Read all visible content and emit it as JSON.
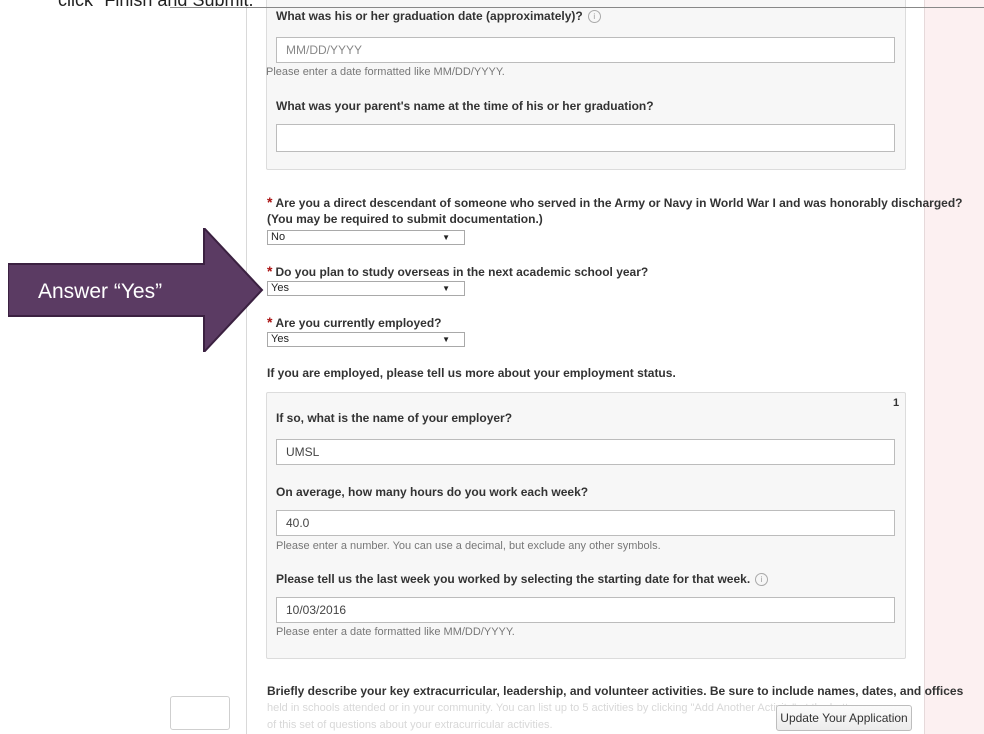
{
  "caption": {
    "text": "click \"Finish and Submit.\""
  },
  "callout": {
    "text": "Answer “Yes”",
    "color": "#5b3b63"
  },
  "graduation": {
    "date_question": "What was his or her graduation date (approximately)?",
    "date_placeholder": "MM/DD/YYYY",
    "date_hint": "Please enter a date formatted like MM/DD/YYYY.",
    "parent_question": "What was your parent's name at the time of his or her graduation?",
    "parent_value": ""
  },
  "descendant": {
    "required_mark": "*",
    "question_line1": "Are you a direct descendant of someone who served in the Army or Navy in World War I and was honorably discharged?",
    "question_line2": "(You may be required to submit documentation.)",
    "selected": "No"
  },
  "overseas": {
    "required_mark": "*",
    "question": "Do you plan to study overseas in the next academic school year?",
    "selected": "Yes"
  },
  "employed": {
    "required_mark": "*",
    "question": "Are you currently employed?",
    "selected": "Yes"
  },
  "employment": {
    "intro": "If you are employed, please tell us more about your employment status.",
    "counter": "1",
    "employer_question": "If so, what is the name of your employer?",
    "employer_value": "UMSL",
    "hours_question": "On average, how many hours do you work each week?",
    "hours_value": "40.0",
    "hours_hint": "Please enter a number. You can use a decimal, but exclude any other symbols.",
    "week_question": "Please tell us the last week you worked by selecting the starting date for that week.",
    "week_value": "10/03/2016",
    "week_hint": "Please enter a date formatted like MM/DD/YYYY."
  },
  "activities": {
    "question": "Briefly describe your key extracurricular, leadership, and volunteer activities. Be sure to include names, dates, and offices",
    "faded_line1": "held in schools attended or in your community. You can list up to 5 activities by clicking \"Add Another Activity\" at the bottom",
    "faded_line2": "of this set of questions about your extracurricular activities."
  },
  "footer": {
    "update_label": "Update Your Application"
  }
}
